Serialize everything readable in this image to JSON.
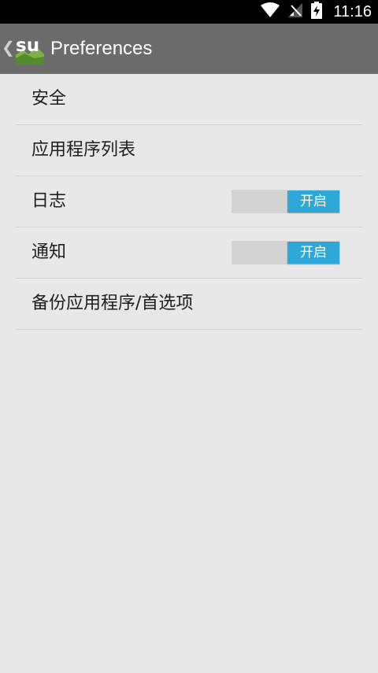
{
  "status_bar": {
    "time": "11:16",
    "icons": [
      "wifi-icon",
      "no-signal-icon",
      "battery-charging-icon"
    ]
  },
  "action_bar": {
    "title": "Preferences",
    "logo_text": "su",
    "up_icon": "chevron-left-icon"
  },
  "preferences": [
    {
      "label": "安全"
    },
    {
      "label": "应用程序列表"
    },
    {
      "label": "日志",
      "toggle": "开启"
    },
    {
      "label": "通知",
      "toggle": "开启"
    },
    {
      "label": "备份应用程序/首选项"
    }
  ],
  "colors": {
    "status_bar": "#000000",
    "action_bar": "#6b6b6b",
    "background": "#e8e8e8",
    "toggle_on": "#2ea8d8",
    "logo_green": "#7cb342"
  }
}
